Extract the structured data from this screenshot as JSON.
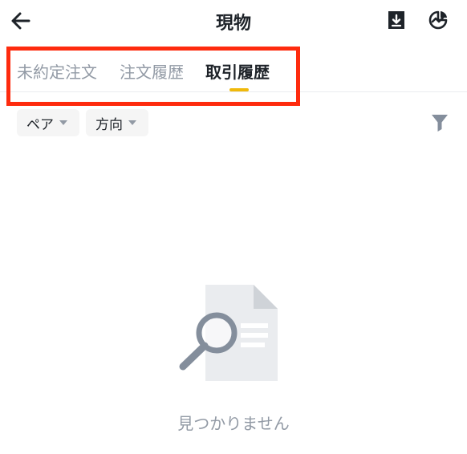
{
  "header": {
    "title": "現物",
    "back_icon": "arrow-left-icon",
    "actions": [
      "download-icon",
      "pie-chart-icon"
    ]
  },
  "tabs": [
    {
      "label": "未約定注文",
      "active": false
    },
    {
      "label": "注文履歴",
      "active": false
    },
    {
      "label": "取引履歴",
      "active": true
    }
  ],
  "filters": {
    "pair_label": "ペア",
    "direction_label": "方向",
    "filter_icon": "funnel-icon"
  },
  "empty_state": {
    "icon": "document-search-icon",
    "message": "見つかりません"
  },
  "colors": {
    "accent": "#f0b90b",
    "highlight": "#fe2b0e",
    "text_primary": "#1e2329",
    "text_secondary": "#929aa5"
  }
}
